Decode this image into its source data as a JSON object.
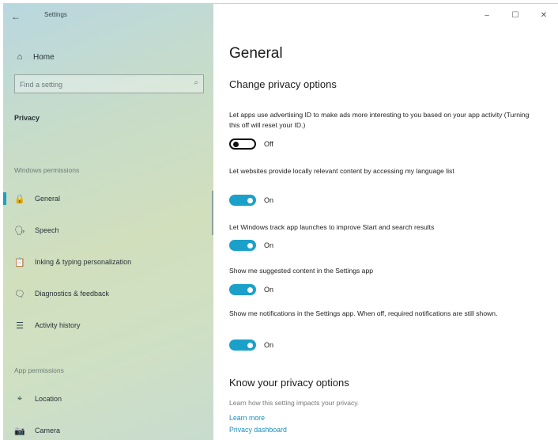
{
  "window": {
    "app_title": "Settings",
    "controls": {
      "minimize": "–",
      "maximize": "☐",
      "close": "✕"
    }
  },
  "sidebar": {
    "back_icon": "←",
    "home": {
      "icon": "home-icon",
      "glyph": "⌂",
      "label": "Home"
    },
    "search": {
      "placeholder": "Find a setting",
      "icon": "search-icon",
      "glyph": "⌕"
    },
    "section_title": "Privacy",
    "windows_permissions_label": "Windows permissions",
    "items": [
      {
        "icon": "lock-icon",
        "glyph": "🔒",
        "label": "General",
        "selected": true
      },
      {
        "icon": "speech-icon",
        "glyph": "🗣",
        "label": "Speech"
      },
      {
        "icon": "clipboard-icon",
        "glyph": "📋",
        "label": "Inking & typing personalization"
      },
      {
        "icon": "feedback-icon",
        "glyph": "🗨",
        "label": "Diagnostics & feedback"
      },
      {
        "icon": "timeline-icon",
        "glyph": "☰",
        "label": "Activity history"
      }
    ],
    "app_permissions_label": "App permissions",
    "app_items": [
      {
        "icon": "location-icon",
        "glyph": "⌖",
        "label": "Location"
      },
      {
        "icon": "camera-icon",
        "glyph": "📷",
        "label": "Camera"
      }
    ]
  },
  "main": {
    "title": "General",
    "change_privacy_heading": "Change privacy options",
    "settings": [
      {
        "desc": "Let apps use advertising ID to make ads more interesting to you based on your app activity (Turning this off will reset your ID.)",
        "state": "Off",
        "on": false
      },
      {
        "desc": "Let websites provide locally relevant content by accessing my language list",
        "state": "On",
        "on": true
      },
      {
        "desc": "Let Windows track app launches to improve Start and search results",
        "state": "On",
        "on": true
      },
      {
        "desc": "Show me suggested content in the Settings app",
        "state": "On",
        "on": true
      },
      {
        "desc": "Show me notifications in the Settings app. When off, required notifications are still shown.",
        "state": "On",
        "on": true
      }
    ],
    "know_heading": "Know your privacy options",
    "know_desc": "Learn how this setting impacts your privacy.",
    "links": {
      "learn_more": "Learn more",
      "privacy_dashboard": "Privacy dashboard"
    }
  },
  "colors": {
    "accent": "#1ba1c9"
  }
}
